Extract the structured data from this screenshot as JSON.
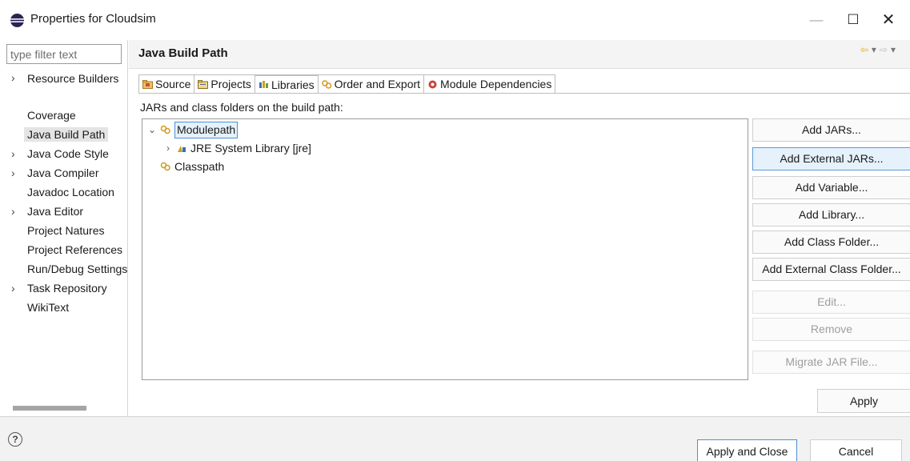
{
  "window": {
    "title": "Properties for Cloudsim",
    "minimize_glyph": "—",
    "maximize_glyph": "☐",
    "close_glyph": "✕"
  },
  "filter": {
    "placeholder": "type filter text"
  },
  "tree": [
    {
      "label": "Resource Builders",
      "expandable": true
    },
    {
      "label": "Coverage",
      "expandable": false
    },
    {
      "label": "Java Build Path",
      "expandable": false,
      "selected": true
    },
    {
      "label": "Java Code Style",
      "expandable": true
    },
    {
      "label": "Java Compiler",
      "expandable": true
    },
    {
      "label": "Javadoc Location",
      "expandable": false
    },
    {
      "label": "Java Editor",
      "expandable": true
    },
    {
      "label": "Project Natures",
      "expandable": false
    },
    {
      "label": "Project References",
      "expandable": false
    },
    {
      "label": "Run/Debug Settings",
      "expandable": false
    },
    {
      "label": "Task Repository",
      "expandable": true
    },
    {
      "label": "WikiText",
      "expandable": false
    }
  ],
  "header": {
    "title": "Java Build Path"
  },
  "tabs": [
    {
      "label": "Source",
      "icon": "source-folder-icon"
    },
    {
      "label": "Projects",
      "icon": "projects-icon"
    },
    {
      "label": "Libraries",
      "icon": "libraries-icon",
      "active": true
    },
    {
      "label": "Order and Export",
      "icon": "order-export-icon"
    },
    {
      "label": "Module Dependencies",
      "icon": "module-dependencies-icon"
    }
  ],
  "build_path_label": "JARs and class folders on the build path:",
  "path_tree": {
    "modulepath": "Modulepath",
    "jre": "JRE System Library [jre]",
    "classpath": "Classpath"
  },
  "buttons": {
    "add_jars": "Add JARs...",
    "add_external_jars": "Add External JARs...",
    "add_variable": "Add Variable...",
    "add_library": "Add Library...",
    "add_class_folder": "Add Class Folder...",
    "add_external_class_folder": "Add External Class Folder...",
    "edit": "Edit...",
    "remove": "Remove",
    "migrate_jar": "Migrate JAR File...",
    "apply": "Apply"
  },
  "footer": {
    "help": "?",
    "apply_and_close": "Apply and Close",
    "cancel": "Cancel"
  },
  "colors": {
    "accent_border": "#4f8fd4",
    "selection_bg": "#e5f1fb",
    "jar_icon": "#c8a21a"
  }
}
